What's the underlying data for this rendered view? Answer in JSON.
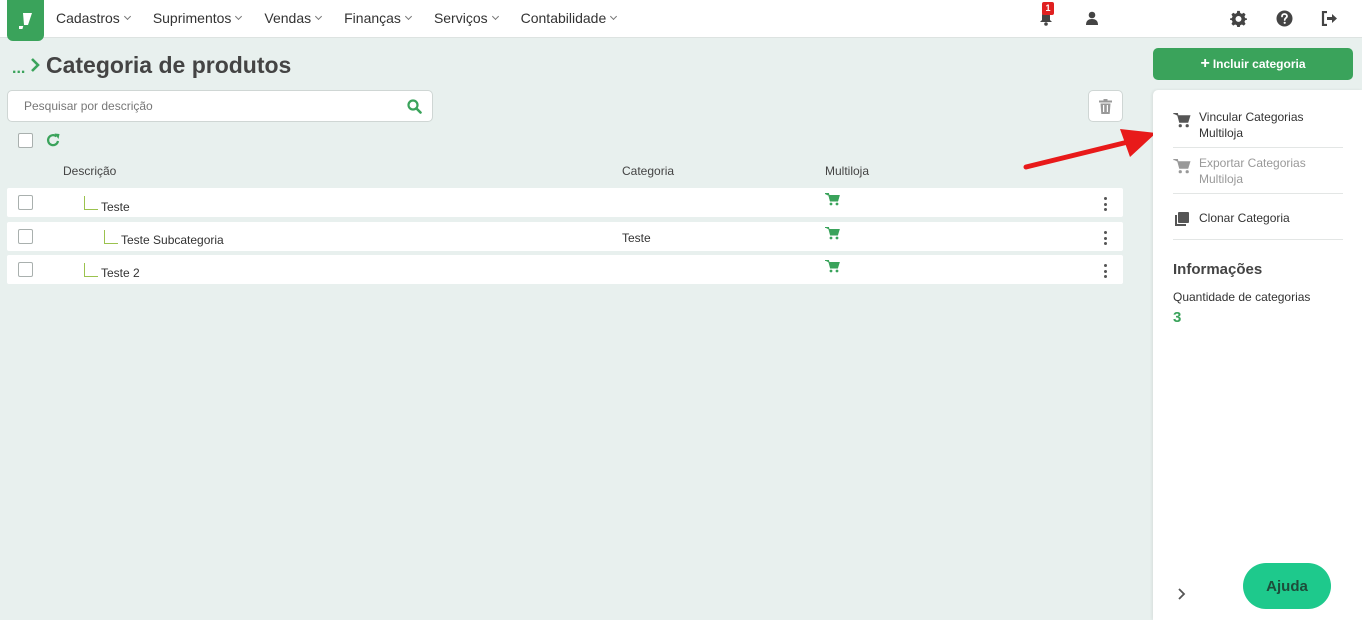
{
  "nav": {
    "items": [
      {
        "label": "Cadastros"
      },
      {
        "label": "Suprimentos"
      },
      {
        "label": "Vendas"
      },
      {
        "label": "Finanças"
      },
      {
        "label": "Serviços"
      },
      {
        "label": "Contabilidade"
      }
    ],
    "notification_count": "1"
  },
  "breadcrumb": {
    "dots": "..."
  },
  "page": {
    "title": "Categoria de produtos"
  },
  "search": {
    "placeholder": "Pesquisar por descrição",
    "value": ""
  },
  "table": {
    "headers": {
      "description": "Descrição",
      "category": "Categoria",
      "multiloja": "Multiloja"
    },
    "rows": [
      {
        "description": "Teste",
        "category": "",
        "level": 1
      },
      {
        "description": "Teste Subcategoria",
        "category": "Teste",
        "level": 2
      },
      {
        "description": "Teste 2",
        "category": "",
        "level": 1
      }
    ]
  },
  "sidebar": {
    "add_button": "Incluir categoria",
    "actions": [
      {
        "label": "Vincular Categorias Multiloja",
        "enabled": true
      },
      {
        "label": "Exportar Categorias Multiloja",
        "enabled": false
      },
      {
        "label": "Clonar Categoria",
        "enabled": true
      }
    ],
    "info_title": "Informações",
    "info_label": "Quantidade de categorias",
    "info_value": "3",
    "help_button": "Ajuda"
  },
  "colors": {
    "brand_green": "#3aa35b",
    "help_green": "#1ec98c",
    "alert_red": "#e02020"
  }
}
